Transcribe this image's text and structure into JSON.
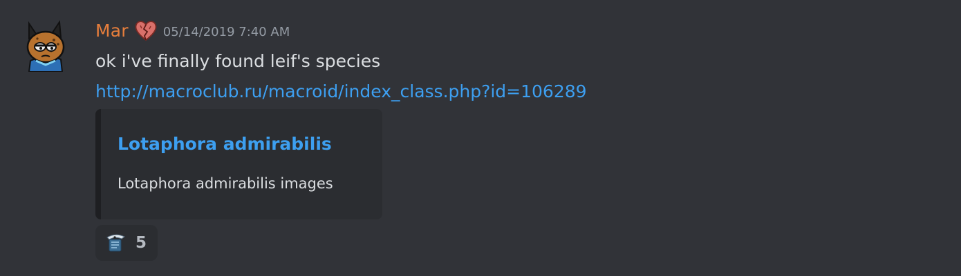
{
  "message": {
    "author": {
      "name": "Mar",
      "name_color": "#e67e3c",
      "avatar_icon": "cat-character-avatar",
      "role_icon": "broken-heart-icon"
    },
    "timestamp": "05/14/2019 7:40 AM",
    "text": "ok i've finally found leif's species",
    "link": "http://macroclub.ru/macroid/index_class.php?id=106289",
    "embed": {
      "title": "Lotaphora admirabilis",
      "description": "Lotaphora admirabilis images"
    },
    "reaction": {
      "emoji_icon": "custom-emoji-icon",
      "count": "5"
    }
  },
  "colors": {
    "background": "#313338",
    "embed_background": "#2b2d31",
    "link": "#3d9ff0",
    "text": "#dbdee1",
    "muted": "#949ba4"
  }
}
